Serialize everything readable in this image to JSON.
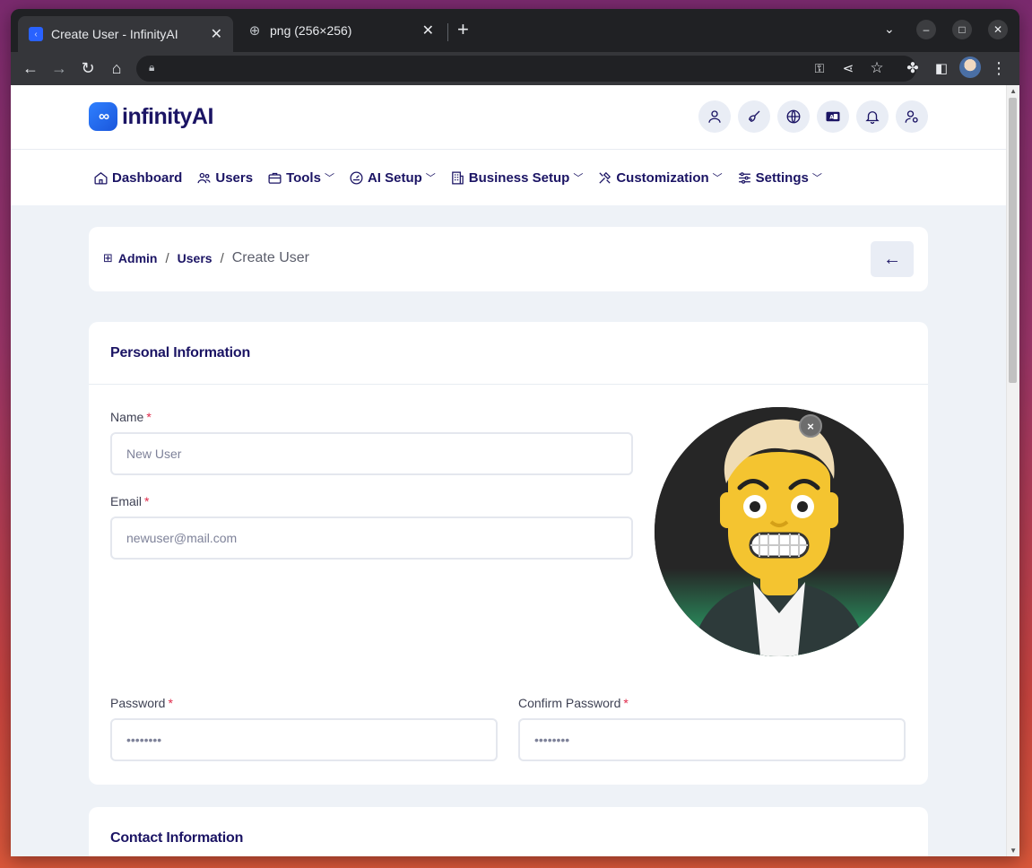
{
  "browser": {
    "tabs": [
      {
        "title": "Create User - InfinityAI",
        "active": true
      },
      {
        "title": "png (256×256)",
        "active": false
      }
    ]
  },
  "app": {
    "logo_mark": "∞",
    "logo_text": "infinityAI",
    "header_icons": [
      "user-icon",
      "broom-icon",
      "globe-icon",
      "language-icon",
      "bell-icon",
      "user-settings-icon"
    ],
    "nav": [
      {
        "label": "Dashboard",
        "icon": "home-icon",
        "dropdown": false
      },
      {
        "label": "Users",
        "icon": "users-icon",
        "dropdown": false
      },
      {
        "label": "Tools",
        "icon": "briefcase-icon",
        "dropdown": true
      },
      {
        "label": "AI Setup",
        "icon": "gauge-icon",
        "dropdown": true
      },
      {
        "label": "Business Setup",
        "icon": "building-icon",
        "dropdown": true
      },
      {
        "label": "Customization",
        "icon": "tools-icon",
        "dropdown": true
      },
      {
        "label": "Settings",
        "icon": "sliders-icon",
        "dropdown": true
      }
    ]
  },
  "breadcrumb": {
    "admin": "Admin",
    "users": "Users",
    "sep": "/",
    "current": "Create User",
    "back": "←"
  },
  "personal": {
    "title": "Personal Information",
    "name_label": "Name",
    "name_placeholder": "New User",
    "email_label": "Email",
    "email_placeholder": "newuser@mail.com",
    "password_label": "Password",
    "password_placeholder": "••••••••",
    "confirm_label": "Confirm Password",
    "confirm_placeholder": "••••••••",
    "required_mark": "*",
    "remove_avatar": "×"
  },
  "contact": {
    "title": "Contact Information"
  }
}
